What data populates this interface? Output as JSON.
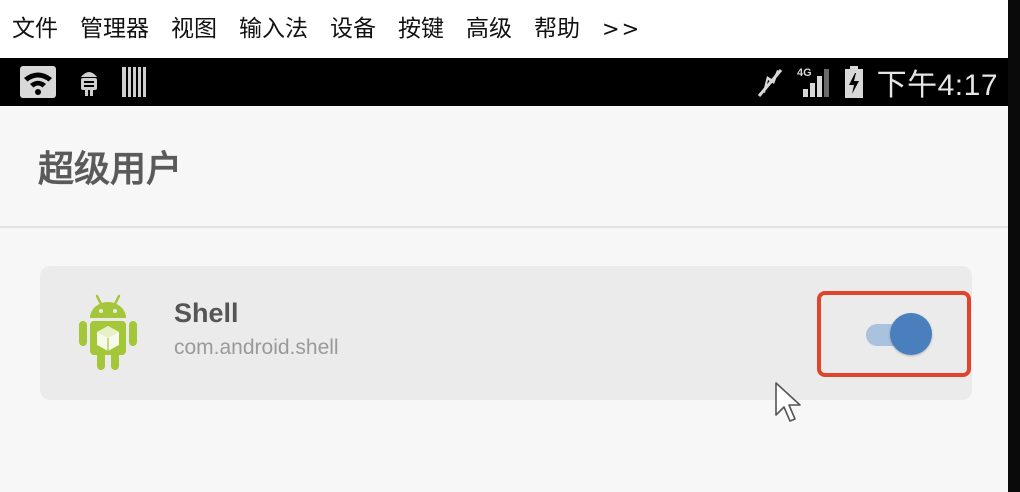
{
  "menubar": {
    "items": [
      {
        "label": "文件"
      },
      {
        "label": "管理器"
      },
      {
        "label": "视图"
      },
      {
        "label": "输入法"
      },
      {
        "label": "设备"
      },
      {
        "label": "按键"
      },
      {
        "label": "高级"
      },
      {
        "label": "帮助"
      }
    ],
    "more_label": ">>"
  },
  "statusbar": {
    "left_icons": [
      "wifi-icon",
      "android-debug-icon",
      "sd-card-icon"
    ],
    "right_icons": [
      "silent-icon",
      "signal-4g-icon",
      "battery-icon"
    ],
    "network_type": "4G",
    "clock": "下午4:17"
  },
  "app": {
    "title": "超级用户",
    "entries": [
      {
        "icon": "android-app-icon",
        "name": "Shell",
        "package": "com.android.shell",
        "enabled": true
      }
    ]
  },
  "colors": {
    "toggle_thumb": "#4a7fbd",
    "toggle_track": "#a9c2dd",
    "highlight": "#e0442a",
    "android_green": "#a4c639"
  }
}
